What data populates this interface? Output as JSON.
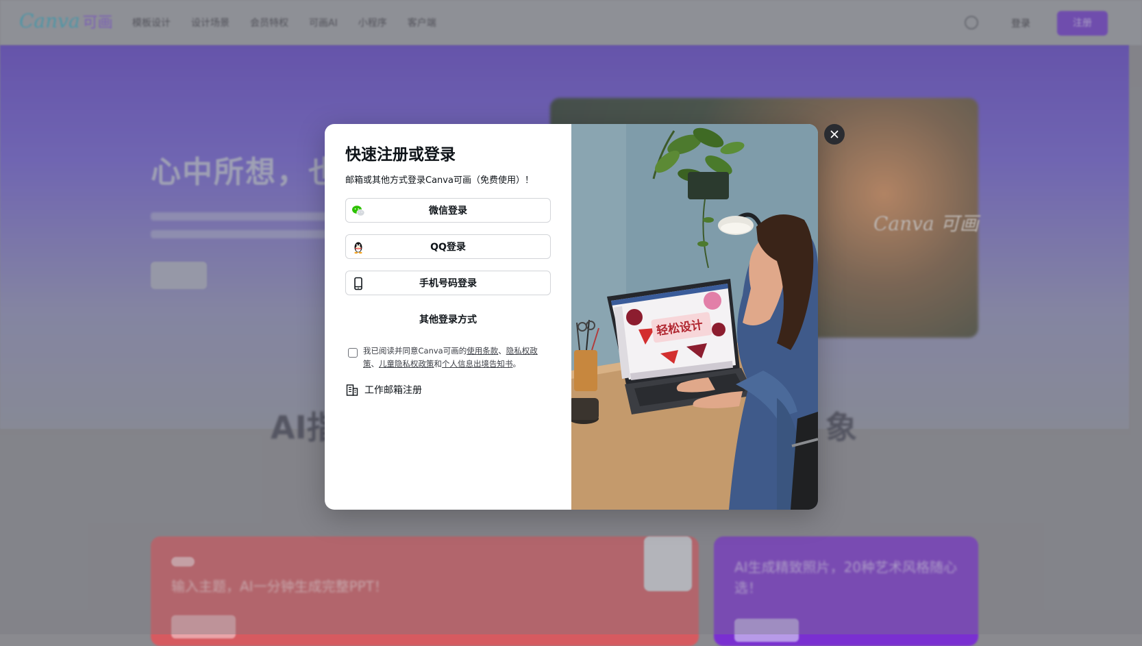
{
  "background": {
    "logo": {
      "text": "Canva",
      "cn": "可画"
    },
    "nav_items": [
      "模板设计",
      "设计场景",
      "会员特权",
      "可画AI",
      "小程序",
      "客户端"
    ],
    "login_label": "登录",
    "signup_label": "注册",
    "hero_title": "心中所想，也",
    "section_title_left": "AI指",
    "section_title_right": "象",
    "red_card_text": "输入主题，AI一分钟生成完整PPT！",
    "purple_card_text": "AI生成精致照片，20种艺术风格随心选！",
    "hero_image_logo": "Canva 可画"
  },
  "modal": {
    "title": "快速注册或登录",
    "subtitle": "邮箱或其他方式登录Canva可画（免费使用）！",
    "wechat_login": "微信登录",
    "qq_login": "QQ登录",
    "phone_login": "手机号码登录",
    "other_login": "其他登录方式",
    "agreement": {
      "prefix": "我已阅读并同意Canva可画的",
      "terms": "使用条款",
      "sep1": "、",
      "privacy": "隐私权政策",
      "sep2": "、",
      "children_privacy": "儿童隐私权政策",
      "and": "和",
      "personal_info": "个人信息出境告知书",
      "suffix": "。"
    },
    "work_email": "工作邮箱注册",
    "screen_text": "轻松设计",
    "close_label": "×"
  },
  "colors": {
    "brand_purple": "#7d2ae8",
    "wechat_green": "#2dc100",
    "qq_black": "#111111",
    "overlay": "#7a7c84"
  }
}
